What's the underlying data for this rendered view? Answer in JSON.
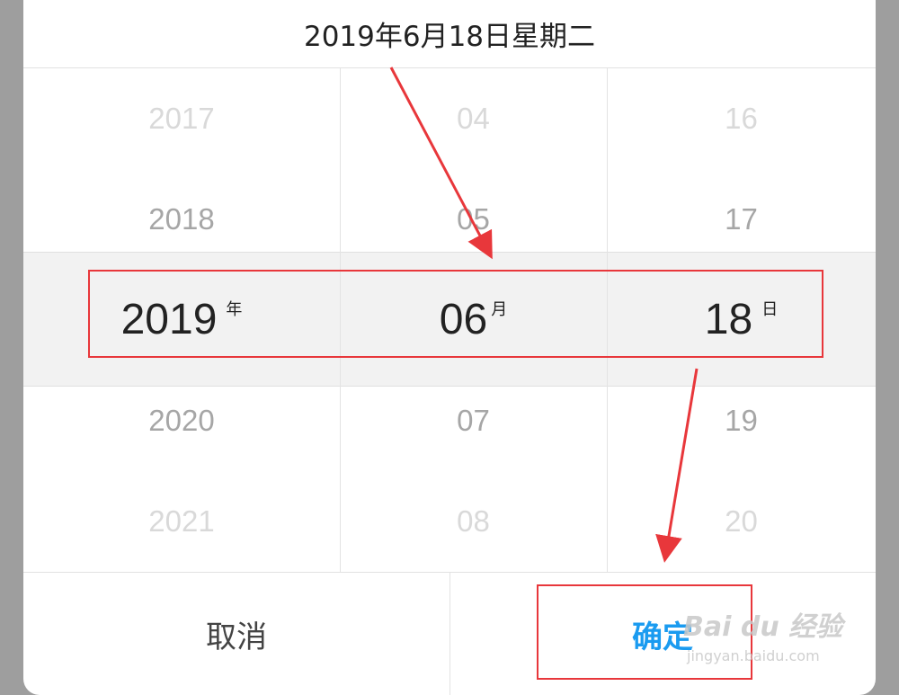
{
  "dialog": {
    "title": "2019年6月18日星期二"
  },
  "picker": {
    "year": {
      "items": [
        "2017",
        "2018",
        "2019",
        "2020",
        "2021"
      ],
      "selected_index": 2,
      "unit": "年"
    },
    "month": {
      "items": [
        "04",
        "05",
        "06",
        "07",
        "08"
      ],
      "selected_index": 2,
      "unit": "月"
    },
    "day": {
      "items": [
        "16",
        "17",
        "18",
        "19",
        "20"
      ],
      "selected_index": 2,
      "unit": "日"
    }
  },
  "buttons": {
    "cancel_label": "取消",
    "confirm_label": "确定"
  },
  "watermark": {
    "main": "Bai du 经验",
    "sub": "jingyan.baidu.com"
  },
  "colors": {
    "confirm": "#1a9bf0",
    "annotation": "#e8373b",
    "selected_band": "#f2f2f2"
  }
}
